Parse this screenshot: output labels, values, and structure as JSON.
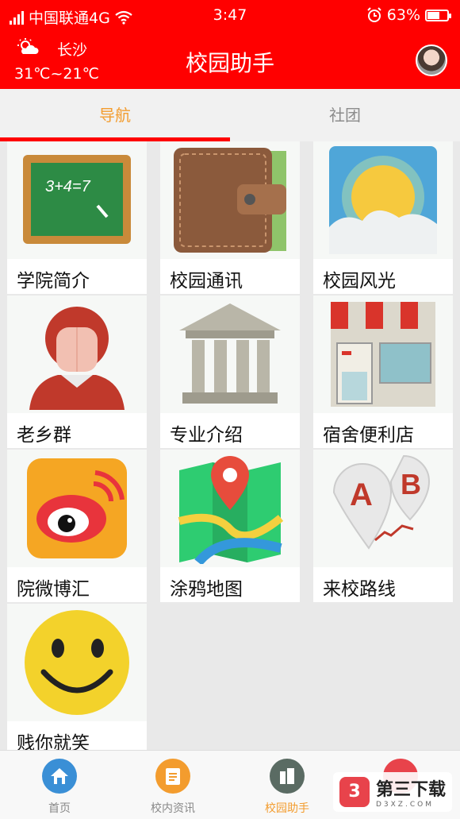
{
  "status_bar": {
    "carrier": "中国联通4G",
    "time": "3:47",
    "battery": "63%",
    "battery_level": 0.63
  },
  "header": {
    "city": "长沙",
    "temperature": "31℃~21℃",
    "title": "校园助手"
  },
  "tabs": [
    {
      "label": "导航",
      "active": true
    },
    {
      "label": "社团",
      "active": false
    }
  ],
  "grid": [
    {
      "label": "学院简介",
      "icon": "chalkboard-icon"
    },
    {
      "label": "校园通讯",
      "icon": "wallet-icon"
    },
    {
      "label": "校园风光",
      "icon": "sun-landscape-icon"
    },
    {
      "label": "老乡群",
      "icon": "person-icon"
    },
    {
      "label": "专业介绍",
      "icon": "building-columns-icon"
    },
    {
      "label": "宿舍便利店",
      "icon": "storefront-icon"
    },
    {
      "label": "院微博汇",
      "icon": "weibo-icon"
    },
    {
      "label": "涂鸦地图",
      "icon": "map-pin-icon"
    },
    {
      "label": "来校路线",
      "icon": "route-ab-icon"
    },
    {
      "label": "贱你就笑",
      "icon": "smiley-icon"
    }
  ],
  "bottom_nav": [
    {
      "label": "首页",
      "color": "#3a8fd6",
      "active": false
    },
    {
      "label": "校内资讯",
      "color": "#f39c2e",
      "active": false
    },
    {
      "label": "校园助手",
      "color": "#5a6b63",
      "active": true
    },
    {
      "label": "",
      "color": "#e8434b",
      "active": false
    }
  ],
  "watermark": {
    "logo": "3",
    "text": "第三下载",
    "sub": "D3XZ.COM"
  },
  "colors": {
    "brand_red": "#ff0000",
    "active_tab": "#f39c2e"
  }
}
